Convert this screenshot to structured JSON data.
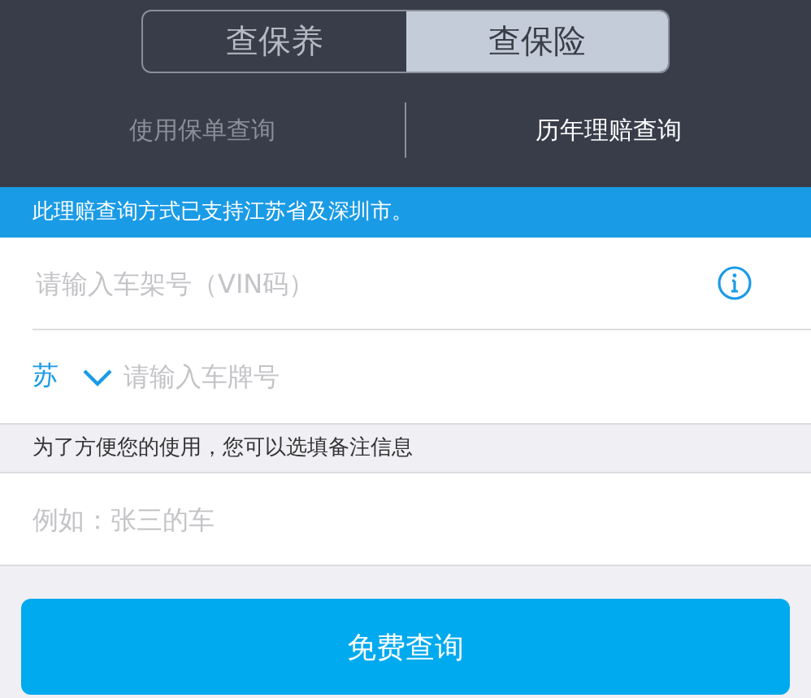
{
  "segments": [
    {
      "label": "查保养",
      "selected": false
    },
    {
      "label": "查保险",
      "selected": true
    }
  ],
  "subtabs": [
    {
      "label": "使用保单查询",
      "selected": false
    },
    {
      "label": "历年理赔查询",
      "selected": true
    }
  ],
  "notice": "此理赔查询方式已支持江苏省及深圳市。",
  "vin_field": {
    "placeholder": "请输入车架号（VIN码）"
  },
  "plate": {
    "province": "苏",
    "placeholder": "请输入车牌号"
  },
  "note": "为了方便您的使用，您可以选填备注信息",
  "memo_field": {
    "placeholder": "例如：张三的车"
  },
  "submit": "免费查询"
}
